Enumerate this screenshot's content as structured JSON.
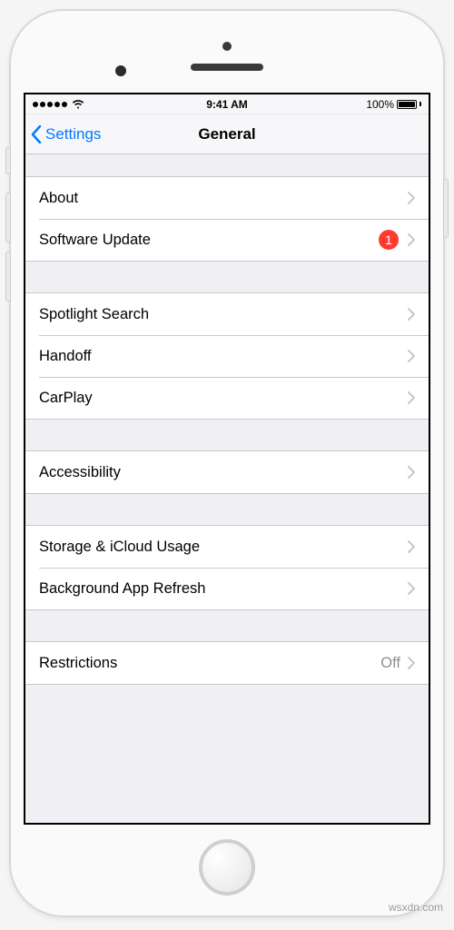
{
  "status_bar": {
    "time": "9:41 AM",
    "battery_pct": "100%"
  },
  "nav": {
    "back_label": "Settings",
    "title": "General"
  },
  "groups": {
    "g1": {
      "about": "About",
      "software_update": {
        "label": "Software Update",
        "badge": "1"
      }
    },
    "g2": {
      "spotlight": "Spotlight Search",
      "handoff": "Handoff",
      "carplay": "CarPlay"
    },
    "g3": {
      "accessibility": "Accessibility"
    },
    "g4": {
      "storage": "Storage & iCloud Usage",
      "background_refresh": "Background App Refresh"
    },
    "g5": {
      "restrictions": {
        "label": "Restrictions",
        "detail": "Off"
      }
    }
  },
  "watermark": "wsxdn.com"
}
